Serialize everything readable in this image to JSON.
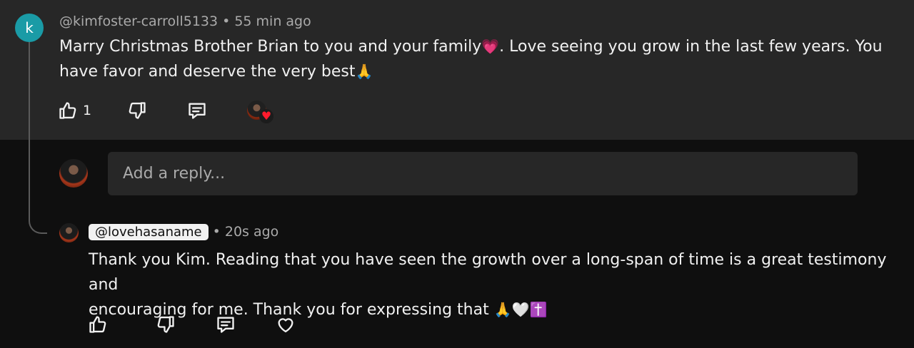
{
  "comment": {
    "avatar_letter": "k",
    "author": "@kimfoster-carroll5133",
    "separator": "•",
    "time": "55 min ago",
    "line1": "Marry Christmas Brother Brian to you and your family",
    "line1_emoji": "💗",
    "line1_tail": ".  Love seeing you grow in the last few years.  You",
    "line2": "have favor and deserve the very best",
    "line2_emoji": "🙏",
    "like_count": "1"
  },
  "reply_input": {
    "placeholder": "Add a reply..."
  },
  "reply": {
    "author": "@lovehasaname",
    "separator": "•",
    "time": "20s ago",
    "line1": "Thank you Kim. Reading that you have seen the growth over a long-span of time is a great testimony and",
    "line2": "encouraging for me. Thank you for expressing that ",
    "line2_emojis": "🙏🤍✝️"
  },
  "icons": [
    "thumb-up-icon",
    "thumb-down-icon",
    "reply-icon",
    "heart-icon"
  ],
  "colors": {
    "background": "#0f0f0f",
    "panel": "#272727",
    "avatar_k": "#1a9ba6",
    "heart_red": "#ff1b2d"
  }
}
